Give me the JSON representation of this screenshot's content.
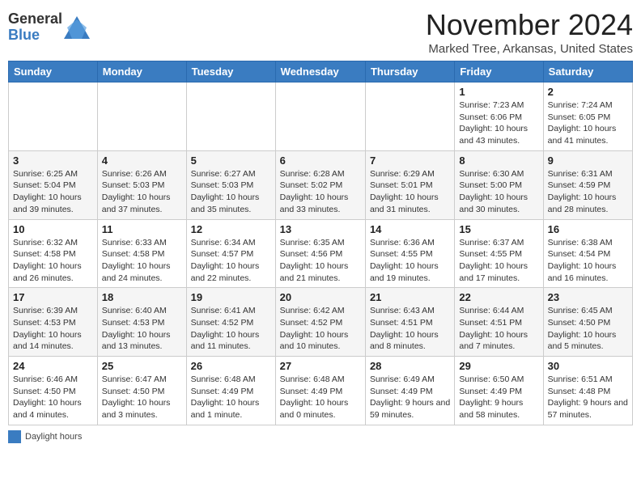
{
  "header": {
    "logo_general": "General",
    "logo_blue": "Blue",
    "month_title": "November 2024",
    "location": "Marked Tree, Arkansas, United States"
  },
  "footer": {
    "daylight_label": "Daylight hours"
  },
  "days_of_week": [
    "Sunday",
    "Monday",
    "Tuesday",
    "Wednesday",
    "Thursday",
    "Friday",
    "Saturday"
  ],
  "weeks": [
    [
      {
        "day": "",
        "info": ""
      },
      {
        "day": "",
        "info": ""
      },
      {
        "day": "",
        "info": ""
      },
      {
        "day": "",
        "info": ""
      },
      {
        "day": "",
        "info": ""
      },
      {
        "day": "1",
        "info": "Sunrise: 7:23 AM\nSunset: 6:06 PM\nDaylight: 10 hours and 43 minutes."
      },
      {
        "day": "2",
        "info": "Sunrise: 7:24 AM\nSunset: 6:05 PM\nDaylight: 10 hours and 41 minutes."
      }
    ],
    [
      {
        "day": "3",
        "info": "Sunrise: 6:25 AM\nSunset: 5:04 PM\nDaylight: 10 hours and 39 minutes."
      },
      {
        "day": "4",
        "info": "Sunrise: 6:26 AM\nSunset: 5:03 PM\nDaylight: 10 hours and 37 minutes."
      },
      {
        "day": "5",
        "info": "Sunrise: 6:27 AM\nSunset: 5:03 PM\nDaylight: 10 hours and 35 minutes."
      },
      {
        "day": "6",
        "info": "Sunrise: 6:28 AM\nSunset: 5:02 PM\nDaylight: 10 hours and 33 minutes."
      },
      {
        "day": "7",
        "info": "Sunrise: 6:29 AM\nSunset: 5:01 PM\nDaylight: 10 hours and 31 minutes."
      },
      {
        "day": "8",
        "info": "Sunrise: 6:30 AM\nSunset: 5:00 PM\nDaylight: 10 hours and 30 minutes."
      },
      {
        "day": "9",
        "info": "Sunrise: 6:31 AM\nSunset: 4:59 PM\nDaylight: 10 hours and 28 minutes."
      }
    ],
    [
      {
        "day": "10",
        "info": "Sunrise: 6:32 AM\nSunset: 4:58 PM\nDaylight: 10 hours and 26 minutes."
      },
      {
        "day": "11",
        "info": "Sunrise: 6:33 AM\nSunset: 4:58 PM\nDaylight: 10 hours and 24 minutes."
      },
      {
        "day": "12",
        "info": "Sunrise: 6:34 AM\nSunset: 4:57 PM\nDaylight: 10 hours and 22 minutes."
      },
      {
        "day": "13",
        "info": "Sunrise: 6:35 AM\nSunset: 4:56 PM\nDaylight: 10 hours and 21 minutes."
      },
      {
        "day": "14",
        "info": "Sunrise: 6:36 AM\nSunset: 4:55 PM\nDaylight: 10 hours and 19 minutes."
      },
      {
        "day": "15",
        "info": "Sunrise: 6:37 AM\nSunset: 4:55 PM\nDaylight: 10 hours and 17 minutes."
      },
      {
        "day": "16",
        "info": "Sunrise: 6:38 AM\nSunset: 4:54 PM\nDaylight: 10 hours and 16 minutes."
      }
    ],
    [
      {
        "day": "17",
        "info": "Sunrise: 6:39 AM\nSunset: 4:53 PM\nDaylight: 10 hours and 14 minutes."
      },
      {
        "day": "18",
        "info": "Sunrise: 6:40 AM\nSunset: 4:53 PM\nDaylight: 10 hours and 13 minutes."
      },
      {
        "day": "19",
        "info": "Sunrise: 6:41 AM\nSunset: 4:52 PM\nDaylight: 10 hours and 11 minutes."
      },
      {
        "day": "20",
        "info": "Sunrise: 6:42 AM\nSunset: 4:52 PM\nDaylight: 10 hours and 10 minutes."
      },
      {
        "day": "21",
        "info": "Sunrise: 6:43 AM\nSunset: 4:51 PM\nDaylight: 10 hours and 8 minutes."
      },
      {
        "day": "22",
        "info": "Sunrise: 6:44 AM\nSunset: 4:51 PM\nDaylight: 10 hours and 7 minutes."
      },
      {
        "day": "23",
        "info": "Sunrise: 6:45 AM\nSunset: 4:50 PM\nDaylight: 10 hours and 5 minutes."
      }
    ],
    [
      {
        "day": "24",
        "info": "Sunrise: 6:46 AM\nSunset: 4:50 PM\nDaylight: 10 hours and 4 minutes."
      },
      {
        "day": "25",
        "info": "Sunrise: 6:47 AM\nSunset: 4:50 PM\nDaylight: 10 hours and 3 minutes."
      },
      {
        "day": "26",
        "info": "Sunrise: 6:48 AM\nSunset: 4:49 PM\nDaylight: 10 hours and 1 minute."
      },
      {
        "day": "27",
        "info": "Sunrise: 6:48 AM\nSunset: 4:49 PM\nDaylight: 10 hours and 0 minutes."
      },
      {
        "day": "28",
        "info": "Sunrise: 6:49 AM\nSunset: 4:49 PM\nDaylight: 9 hours and 59 minutes."
      },
      {
        "day": "29",
        "info": "Sunrise: 6:50 AM\nSunset: 4:49 PM\nDaylight: 9 hours and 58 minutes."
      },
      {
        "day": "30",
        "info": "Sunrise: 6:51 AM\nSunset: 4:48 PM\nDaylight: 9 hours and 57 minutes."
      }
    ]
  ]
}
